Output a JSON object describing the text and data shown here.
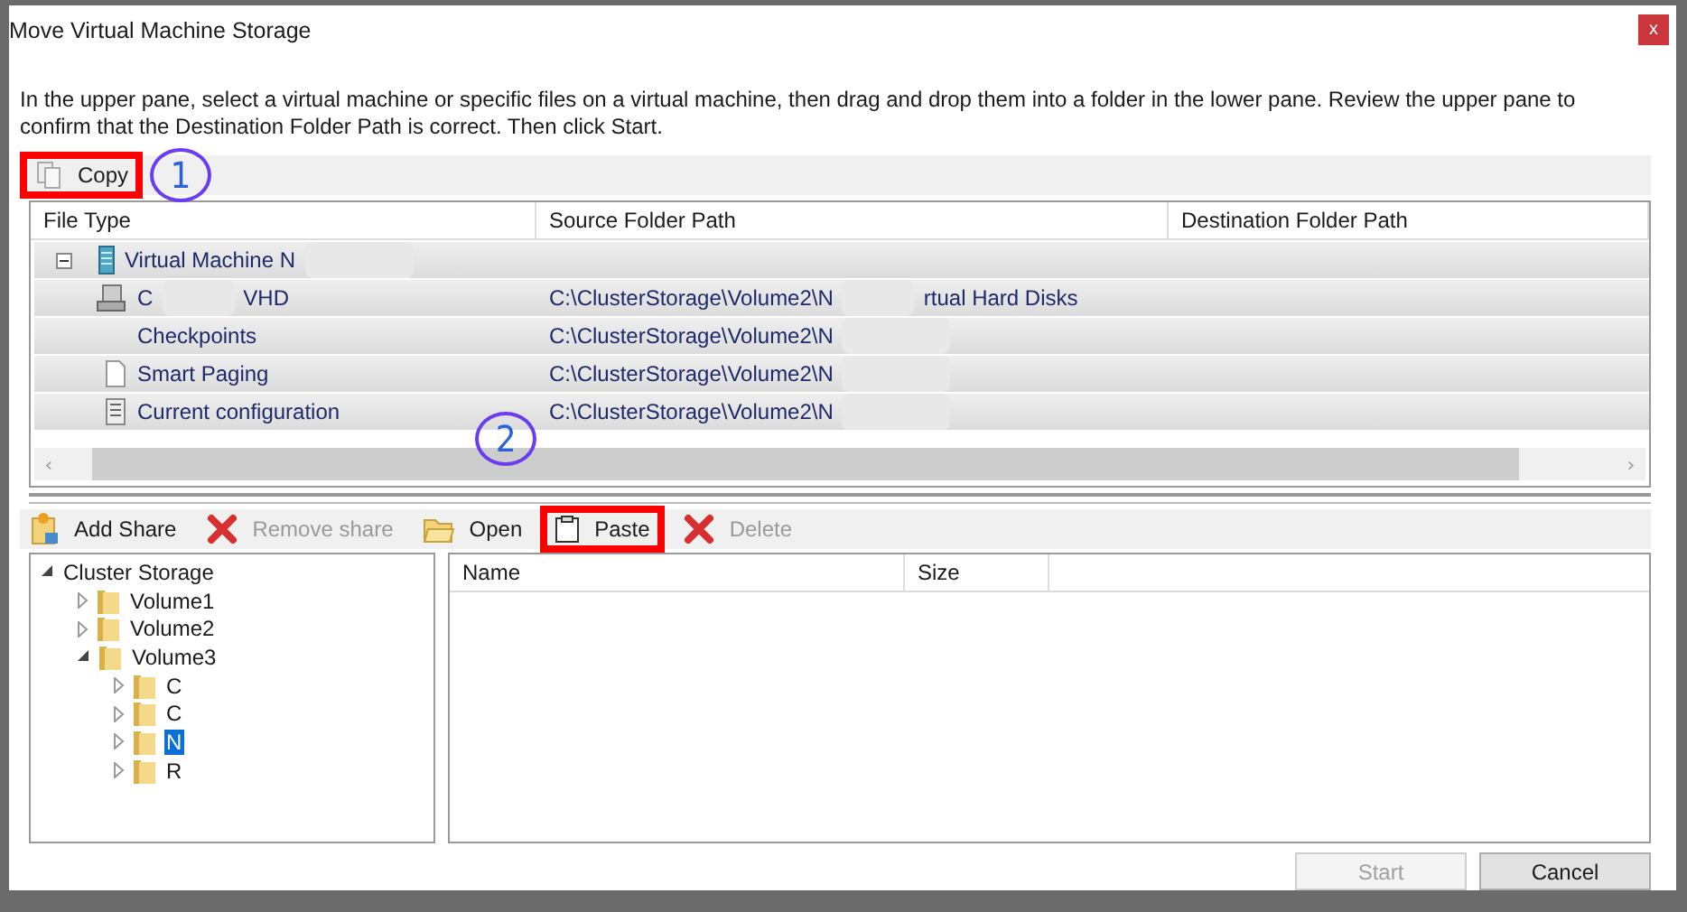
{
  "window": {
    "title": "Move Virtual Machine Storage",
    "close": "x"
  },
  "instructions": "In the upper pane, select a virtual machine or specific files on a virtual machine, then drag and drop them into a folder in the lower pane.  Review the upper pane to\nconfirm that the Destination Folder Path is correct. Then click Start.",
  "upper_toolbar": [
    {
      "label": "Copy",
      "disabled": false,
      "highlighted": true,
      "callout": "1"
    }
  ],
  "upper_table": {
    "columns": [
      "File Type",
      "Source Folder Path",
      "Destination Folder Path"
    ],
    "rows": [
      {
        "kind": "group",
        "expanded": true,
        "file_type": {
          "text": "Virtual Machine N",
          "redacted": true
        }
      },
      {
        "kind": "item",
        "file_type": {
          "text": "C",
          "redacted": true,
          "after": "VHD"
        },
        "source": {
          "text": "C:\\ClusterStorage\\Volume2\\N",
          "redacted": true,
          "after": "rtual Hard Disks"
        }
      },
      {
        "kind": "item",
        "file_type": {
          "text": "Checkpoints"
        },
        "source": {
          "text": "C:\\ClusterStorage\\Volume2\\N",
          "redacted": true
        }
      },
      {
        "kind": "item",
        "file_type": {
          "text": "Smart Paging"
        },
        "source": {
          "text": "C:\\ClusterStorage\\Volume2\\N",
          "redacted": true
        }
      },
      {
        "kind": "item",
        "file_type": {
          "text": "Current configuration"
        },
        "source": {
          "text": "C:\\ClusterStorage\\Volume2\\N",
          "redacted": true
        }
      }
    ]
  },
  "scrollbar": {
    "left": "‹",
    "right": "›"
  },
  "lower_toolbar": [
    {
      "label": "Add Share",
      "disabled": false,
      "highlighted": false
    },
    {
      "label": "Remove share",
      "disabled": true,
      "highlighted": false
    },
    {
      "label": "Open",
      "disabled": false,
      "highlighted": false
    },
    {
      "label": "Paste",
      "disabled": false,
      "highlighted": true,
      "callout": "2"
    },
    {
      "label": "Delete",
      "disabled": true,
      "highlighted": false
    }
  ],
  "tree": [
    {
      "label": "Cluster Storage",
      "expanded": true,
      "selected": false,
      "children": [
        {
          "label": "Volume1",
          "expanded": false,
          "selected": false
        },
        {
          "label": "Volume2",
          "expanded": false,
          "selected": false
        },
        {
          "label": "Volume3",
          "expanded": true,
          "selected": false,
          "children": [
            {
              "label": "C",
              "expanded": false,
              "selected": false
            },
            {
              "label": "C",
              "expanded": false,
              "selected": false
            },
            {
              "label": "N",
              "expanded": false,
              "selected": true
            },
            {
              "label": "R",
              "expanded": false,
              "selected": false
            }
          ]
        }
      ]
    }
  ],
  "lower_list": {
    "columns": [
      "Name",
      "Size"
    ]
  },
  "buttons": [
    {
      "label": "Start",
      "disabled": true
    },
    {
      "label": "Cancel",
      "disabled": false
    }
  ]
}
